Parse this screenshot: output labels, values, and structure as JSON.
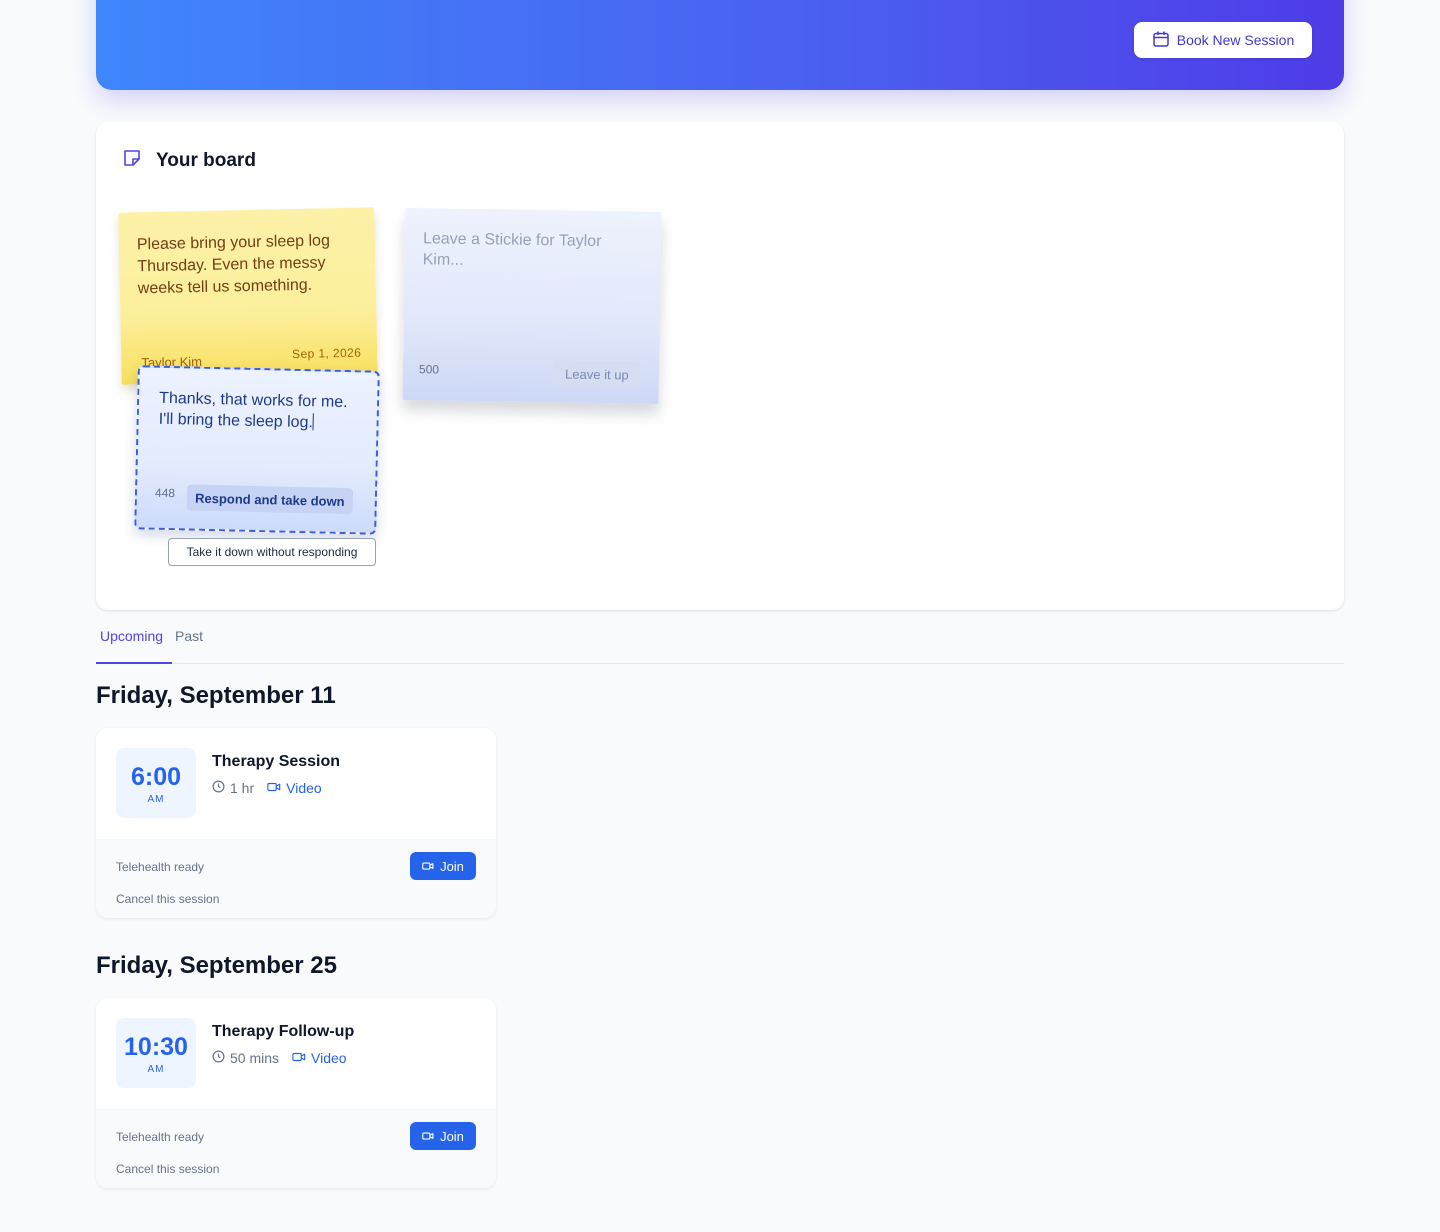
{
  "hero": {
    "book_label": "Book New Session",
    "gradient_start": "#3f86fb",
    "gradient_end": "#4f3ce8"
  },
  "board": {
    "title": "Your board",
    "stickie": {
      "text": "Please bring your sleep log Thursday. Even the messy weeks tell us something.",
      "author": "Taylor Kim",
      "date": "Sep 1, 2026"
    },
    "reply": {
      "value": "Thanks, that works for me. I'll bring the sleep log.",
      "remaining": "448",
      "respond_label": "Respond and take down"
    },
    "takedown_label": "Take it down without responding",
    "new_stickie": {
      "placeholder": "Leave a Stickie for Taylor Kim...",
      "remaining": "500",
      "leave_label": "Leave it up"
    }
  },
  "tabs": [
    {
      "label": "Upcoming",
      "active": true
    },
    {
      "label": "Past",
      "active": false
    }
  ],
  "days": [
    {
      "heading": "Friday, September 11",
      "session": {
        "time": "6:00",
        "ampm": "AM",
        "title": "Therapy Session",
        "duration": "1 hr",
        "mode": "Video",
        "status": "Telehealth ready",
        "join_label": "Join",
        "cancel_label": "Cancel this session"
      }
    },
    {
      "heading": "Friday, September 25",
      "session": {
        "time": "10:30",
        "ampm": "AM",
        "title": "Therapy Follow-up",
        "duration": "50 mins",
        "mode": "Video",
        "status": "Telehealth ready",
        "join_label": "Join",
        "cancel_label": "Cancel this session"
      }
    }
  ],
  "colors": {
    "accent": "#4f46e5",
    "primary": "#2563eb",
    "stickie_yellow": "#fcef9c",
    "stickie_blue": "#e3ebfd"
  },
  "icons": {
    "book": "calendar-icon",
    "board": "sticky-note-icon",
    "duration": "clock-icon",
    "mode": "video-camera-icon"
  }
}
